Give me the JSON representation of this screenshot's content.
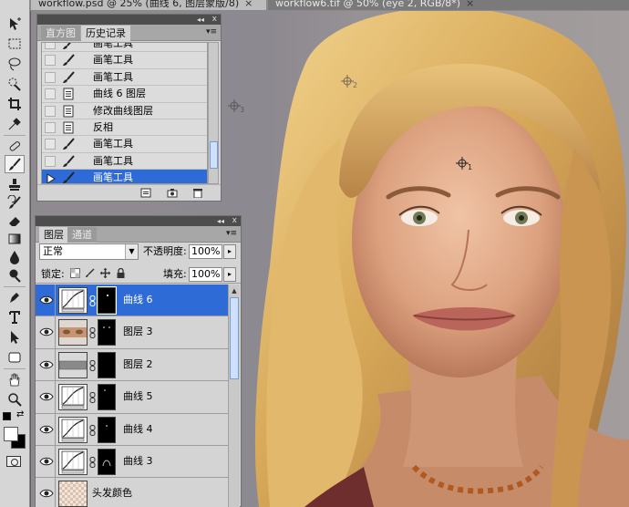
{
  "document_tabs": [
    {
      "label": "workflow.psd @ 25% (曲线 6, 图层蒙版/8)",
      "close": "×",
      "active": true
    },
    {
      "label": "workflow6.tif @ 50% (eye 2, RGB/8*)",
      "close": "×",
      "active": false
    }
  ],
  "tools": [
    {
      "icon": "move-icon"
    },
    {
      "icon": "marquee-icon"
    },
    {
      "icon": "lasso-icon"
    },
    {
      "icon": "quick-selection-icon"
    },
    {
      "icon": "crop-icon"
    },
    {
      "icon": "eyedropper-icon"
    },
    {
      "icon": "healing-brush-icon"
    },
    {
      "icon": "brush-icon",
      "selected": true
    },
    {
      "icon": "clone-stamp-icon"
    },
    {
      "icon": "history-brush-icon"
    },
    {
      "icon": "eraser-icon"
    },
    {
      "icon": "gradient-icon"
    },
    {
      "icon": "blur-icon"
    },
    {
      "icon": "dodge-icon"
    },
    {
      "icon": "pen-icon"
    },
    {
      "icon": "type-icon"
    },
    {
      "icon": "path-selection-icon"
    },
    {
      "icon": "shape-icon"
    },
    {
      "icon": "hand-icon"
    },
    {
      "icon": "zoom-icon"
    }
  ],
  "colors": {
    "foreground": "#ffffff",
    "background": "#000000",
    "selection": "#2f6bd6"
  },
  "history_panel": {
    "tabs": [
      "直方图",
      "历史记录"
    ],
    "active_tab": "历史记录",
    "panel_controls": {
      "collapse": "◂◂",
      "close": "x",
      "menu": "▾≡"
    },
    "items": [
      {
        "label": "画笔工具",
        "icon": "brush-icon"
      },
      {
        "label": "画笔工具",
        "icon": "brush-icon"
      },
      {
        "label": "画笔工具",
        "icon": "brush-icon"
      },
      {
        "label": "曲线 6 图层",
        "icon": "document-icon"
      },
      {
        "label": "修改曲线图层",
        "icon": "document-icon"
      },
      {
        "label": "反相",
        "icon": "document-icon"
      },
      {
        "label": "画笔工具",
        "icon": "brush-icon"
      },
      {
        "label": "画笔工具",
        "icon": "brush-icon"
      },
      {
        "label": "画笔工具",
        "icon": "brush-icon",
        "selected": true
      }
    ],
    "footer_icons": [
      "new-document-from-state-icon",
      "new-snapshot-icon",
      "trash-icon"
    ]
  },
  "layers_panel": {
    "tabs": [
      "图层",
      "通道"
    ],
    "active_tab": "图层",
    "panel_controls": {
      "collapse": "◂◂",
      "close": "x",
      "menu": "▾≡"
    },
    "blend_mode": "正常",
    "opacity_label": "不透明度:",
    "opacity": "100%",
    "lock_label": "锁定:",
    "fill_label": "填充:",
    "fill": "100%",
    "step_arrow": "▸",
    "dropdown_arrow": "▼",
    "layers": [
      {
        "name": "曲线 6",
        "type": "curves",
        "selected": true
      },
      {
        "name": "图层 3",
        "type": "eyes"
      },
      {
        "name": "图层 2",
        "type": "gray"
      },
      {
        "name": "曲线 5",
        "type": "curves"
      },
      {
        "name": "曲线 4",
        "type": "curves"
      },
      {
        "name": "曲线 3",
        "type": "curves"
      },
      {
        "name": "头发颜色",
        "type": "checker"
      }
    ]
  },
  "canvas": {
    "sample_markers": [
      {
        "label": "1",
        "icon": "color-sampler-icon"
      },
      {
        "label": "2",
        "icon": "color-sampler-icon"
      },
      {
        "label": "3",
        "icon": "color-sampler-icon"
      }
    ]
  }
}
